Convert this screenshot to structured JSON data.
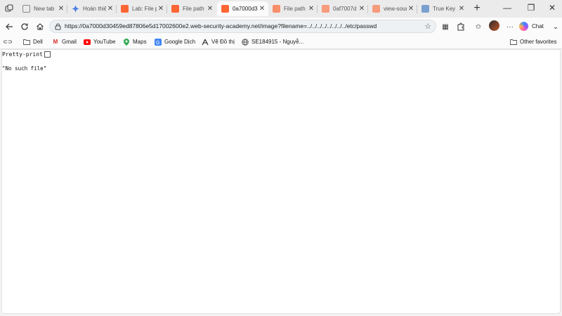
{
  "tabs": [
    {
      "title": "New tab",
      "favicon": "newtab-icon",
      "active": false
    },
    {
      "title": "Hoàn thiệ",
      "favicon": "gemini-icon",
      "active": false
    },
    {
      "title": "Lab: File pa",
      "favicon": "portswigger-icon",
      "active": false
    },
    {
      "title": "File path tr",
      "favicon": "portswigger-icon",
      "active": false
    },
    {
      "title": "0a7000d3",
      "favicon": "portswigger-icon",
      "active": true
    },
    {
      "title": "File path tr",
      "favicon": "portswigger-icon",
      "active": false
    },
    {
      "title": "0af7007d",
      "favicon": "document-icon",
      "active": false
    },
    {
      "title": "view-sour",
      "favicon": "portswigger-icon",
      "active": false
    },
    {
      "title": "True Key",
      "favicon": "truekey-icon",
      "active": false
    }
  ],
  "address": {
    "url": "https://0a7000d30459ed87806e5d17002600e2.web-security-academy.net/image?filename=../../../../../../../../etc/passwd"
  },
  "toolbar": {
    "chat_label": "Chat"
  },
  "bookmarks": [
    {
      "label": "Dell",
      "icon": "folder-icon"
    },
    {
      "label": "Gmail",
      "icon": "gmail-icon"
    },
    {
      "label": "YouTube",
      "icon": "youtube-icon"
    },
    {
      "label": "Maps",
      "icon": "maps-icon"
    },
    {
      "label": "Google Dịch",
      "icon": "translate-icon"
    },
    {
      "label": "Vẽ Đồ thị",
      "icon": "graph-icon"
    },
    {
      "label": "SE184915 - Nguyễ...",
      "icon": "globe-icon"
    }
  ],
  "other_favorites": "Other favorites",
  "page": {
    "pretty_print_label": "Pretty-print",
    "pretty_print_checked": false,
    "body_text": "\"No such file\""
  },
  "colors": {
    "portswigger": "#ff6633",
    "tab_strip": "#ebebeb",
    "toolbar": "#fbfbfb"
  }
}
